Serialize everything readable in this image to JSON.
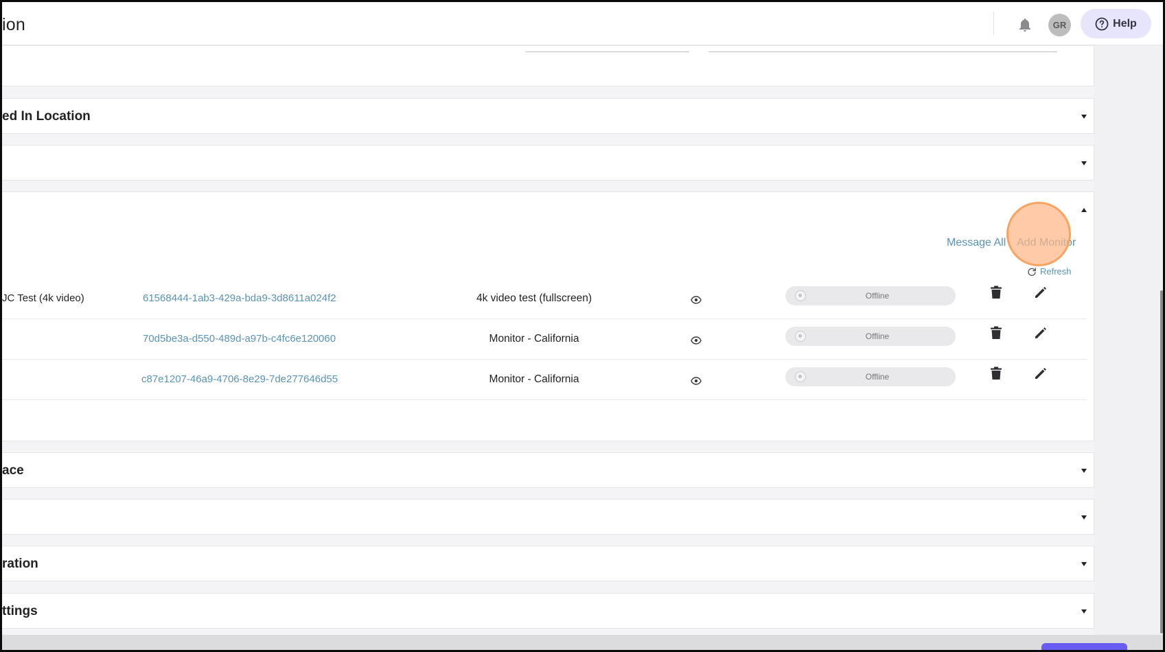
{
  "header": {
    "title": "ion",
    "avatar_initials": "GR",
    "help_label": "Help",
    "icons": [
      "bell-icon",
      "help-circle-icon"
    ]
  },
  "panels": {
    "p1": {
      "title": ""
    },
    "p2": {
      "title": "ed In Location"
    },
    "p3": {
      "title": ""
    },
    "monitors": {
      "title": ""
    },
    "p5": {
      "title": "ace"
    },
    "p6": {
      "title": ""
    },
    "p7": {
      "title": "ration"
    },
    "p8": {
      "title": "ttings"
    }
  },
  "monitors": {
    "message_all_label": "Message All",
    "add_monitor_label": "Add Monitor",
    "refresh_label": "Refresh",
    "rows": [
      {
        "name": "JC Test (4k video)",
        "id": "61568444-1ab3-429a-bda9-3d8611a024f2",
        "description": "4k video test (fullscreen)",
        "status": "Offline"
      },
      {
        "name": "",
        "id": "70d5be3a-d550-489d-a97b-c4fc6e120060",
        "description": "Monitor - California",
        "status": "Offline"
      },
      {
        "name": "",
        "id": "c87e1207-46a9-4706-8e29-7de277646d55",
        "description": "Monitor - California",
        "status": "Offline"
      }
    ]
  },
  "colors": {
    "link": "#5a94b3",
    "help_bg": "#e6e5fb",
    "highlight": "#fdb686",
    "primary_button": "#6a5cf2"
  }
}
